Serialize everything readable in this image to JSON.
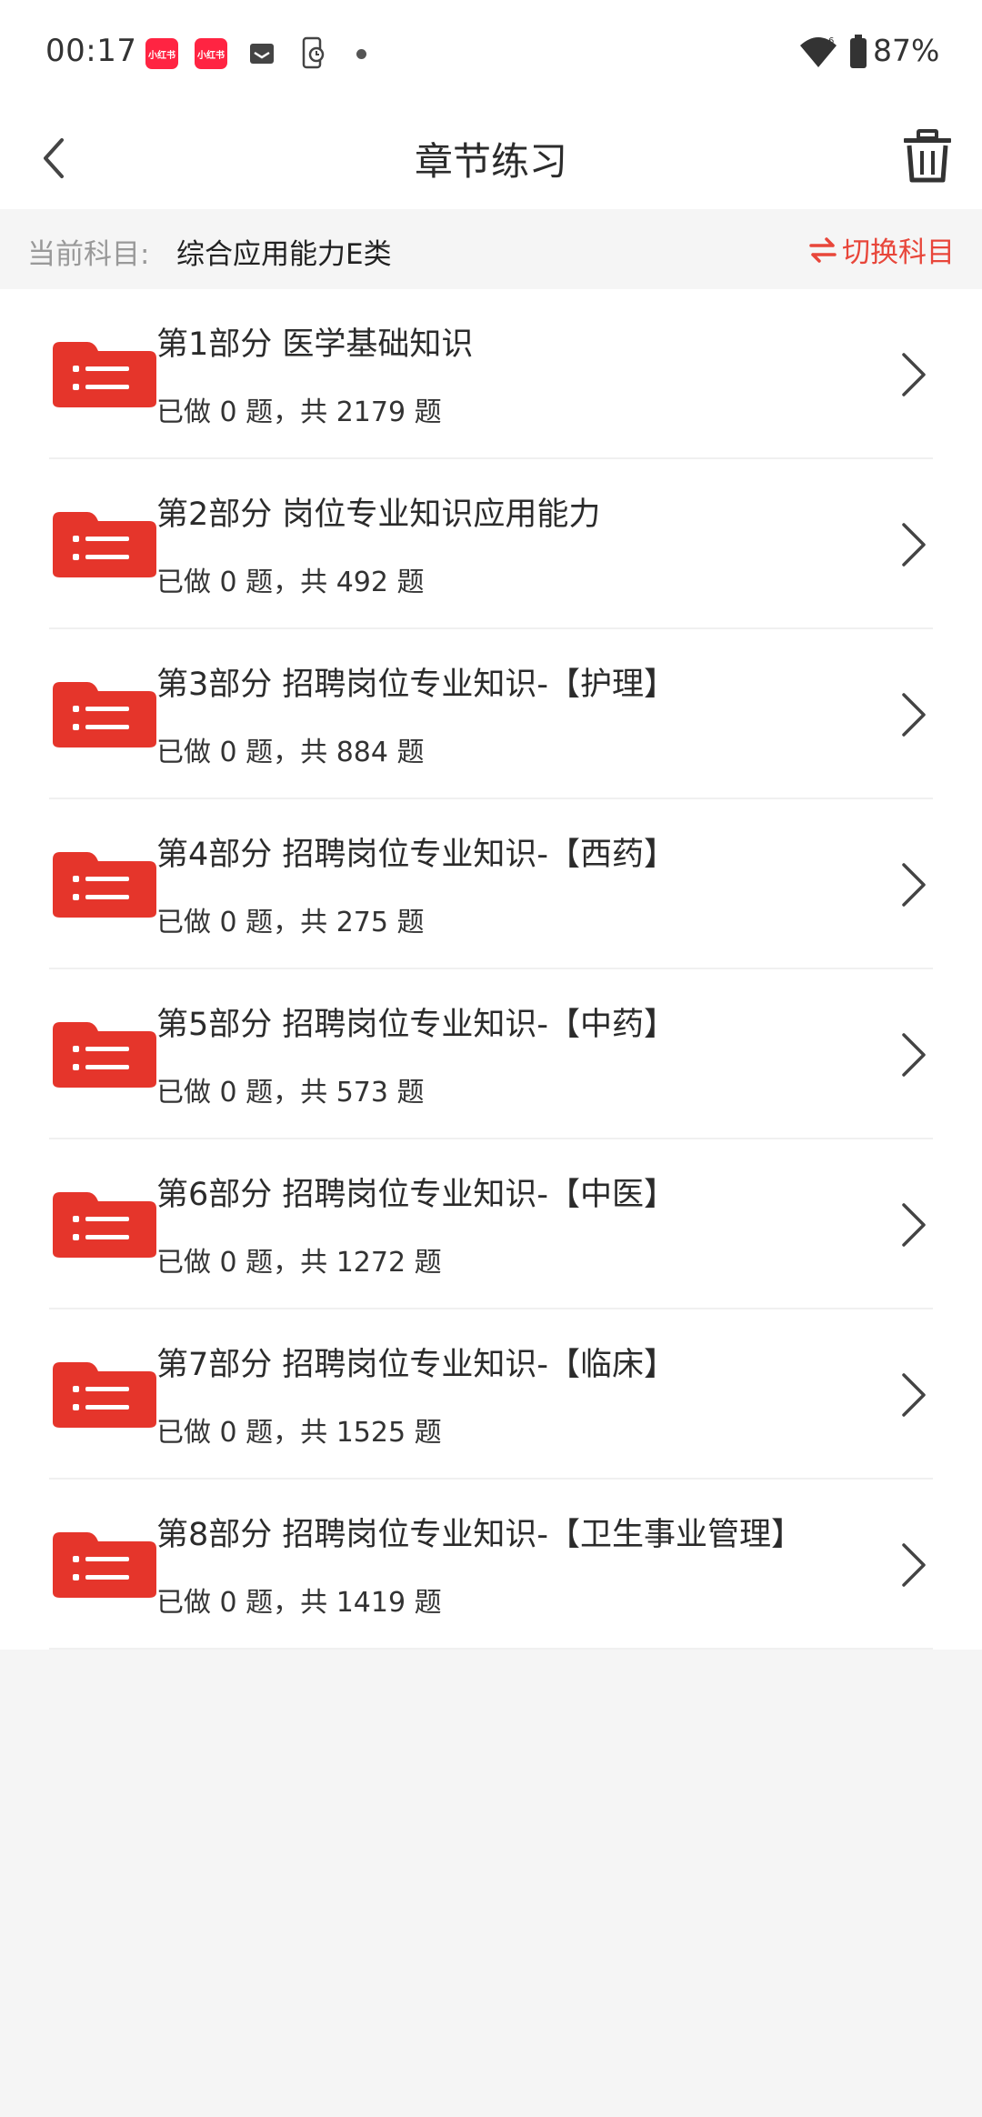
{
  "status_bar": {
    "time": "00:17",
    "notif_label": "小红书",
    "battery": "87%"
  },
  "nav": {
    "title": "章节练习"
  },
  "subject": {
    "label": "当前科目:",
    "value": "综合应用能力E类",
    "switch_label": "切换科目"
  },
  "chapters": [
    {
      "title": "第1部分 医学基础知识",
      "progress": "已做 0 题，共 2179 题"
    },
    {
      "title": "第2部分 岗位专业知识应用能力",
      "progress": "已做 0 题，共 492 题"
    },
    {
      "title": "第3部分 招聘岗位专业知识-【护理】",
      "progress": "已做 0 题，共 884 题"
    },
    {
      "title": "第4部分 招聘岗位专业知识-【西药】",
      "progress": "已做 0 题，共 275 题"
    },
    {
      "title": "第5部分 招聘岗位专业知识-【中药】",
      "progress": "已做 0 题，共 573 题"
    },
    {
      "title": "第6部分 招聘岗位专业知识-【中医】",
      "progress": "已做 0 题，共 1272 题"
    },
    {
      "title": "第7部分 招聘岗位专业知识-【临床】",
      "progress": "已做 0 题，共 1525 题"
    },
    {
      "title": "第8部分 招聘岗位专业知识-【卫生事业管理】",
      "progress": "已做 0 题，共 1419 题"
    }
  ],
  "colors": {
    "accent": "#e8463a",
    "folder": "#e5352b"
  }
}
